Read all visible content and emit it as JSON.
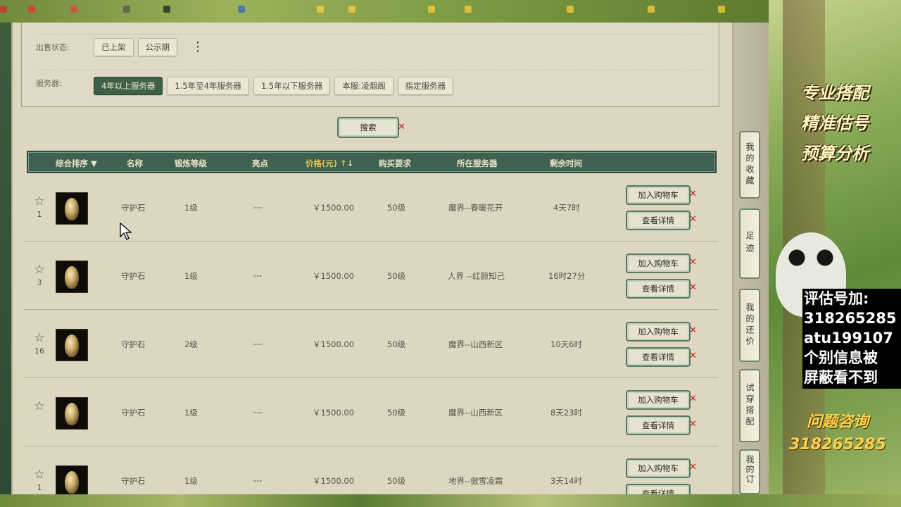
{
  "filters": {
    "sale_status": {
      "label": "出售状态:",
      "options": [
        "已上架",
        "公示期"
      ]
    },
    "server": {
      "label": "服务器:",
      "options": [
        "4年以上服务器",
        "1.5年至4年服务器",
        "1.5年以下服务器",
        "本服:凌烟阁",
        "指定服务器"
      ],
      "active_index": 0
    },
    "search_label": "搜索"
  },
  "table": {
    "headers": {
      "sort": "综合排序",
      "name": "名称",
      "level": "锻炼等级",
      "highlight": "亮点",
      "price": "价格(元)",
      "requirement": "购买要求",
      "server": "所在服务器",
      "time_left": "剩余时间"
    },
    "rows": [
      {
        "rank": "1",
        "name": "守护石",
        "level": "1级",
        "highlight": "---",
        "price": "￥1500.00",
        "requirement": "50级",
        "server": "魔界--春暖花开",
        "time_left": "4天7时"
      },
      {
        "rank": "3",
        "name": "守护石",
        "level": "1级",
        "highlight": "---",
        "price": "￥1500.00",
        "requirement": "50级",
        "server": "人界 --红颜知己",
        "time_left": "16时27分"
      },
      {
        "rank": "16",
        "name": "守护石",
        "level": "2级",
        "highlight": "---",
        "price": "￥1500.00",
        "requirement": "50级",
        "server": "魔界--山西新区",
        "time_left": "10天6时"
      },
      {
        "rank": "",
        "name": "守护石",
        "level": "1级",
        "highlight": "---",
        "price": "￥1500.00",
        "requirement": "50级",
        "server": "魔界--山西新区",
        "time_left": "8天23时"
      },
      {
        "rank": "1",
        "name": "守护石",
        "level": "1级",
        "highlight": "---",
        "price": "￥1500.00",
        "requirement": "50级",
        "server": "地界--傲雪凌霜",
        "time_left": "3天14时"
      }
    ],
    "add_cart_label": "加入购物车",
    "view_detail_label": "查看详情"
  },
  "sidebar_tabs": [
    "我的收藏",
    "足迹",
    "我的还价",
    "试穿搭配",
    "我的订"
  ],
  "ad": {
    "slogans": [
      "专业搭配",
      "精准估号",
      "预算分析"
    ],
    "contact_lines": [
      "评估号加:",
      "318265285",
      "atu199107",
      "个别信息被",
      "屏蔽看不到"
    ],
    "consult_label": "问题咨询",
    "consult_number": "318265285"
  },
  "colors": {
    "header_green": "#3e6150",
    "active_chip": "#3e6047",
    "page_bg": "#ddd6c1",
    "price_gold": "#e6c25c",
    "close_red": "#c2261b"
  }
}
